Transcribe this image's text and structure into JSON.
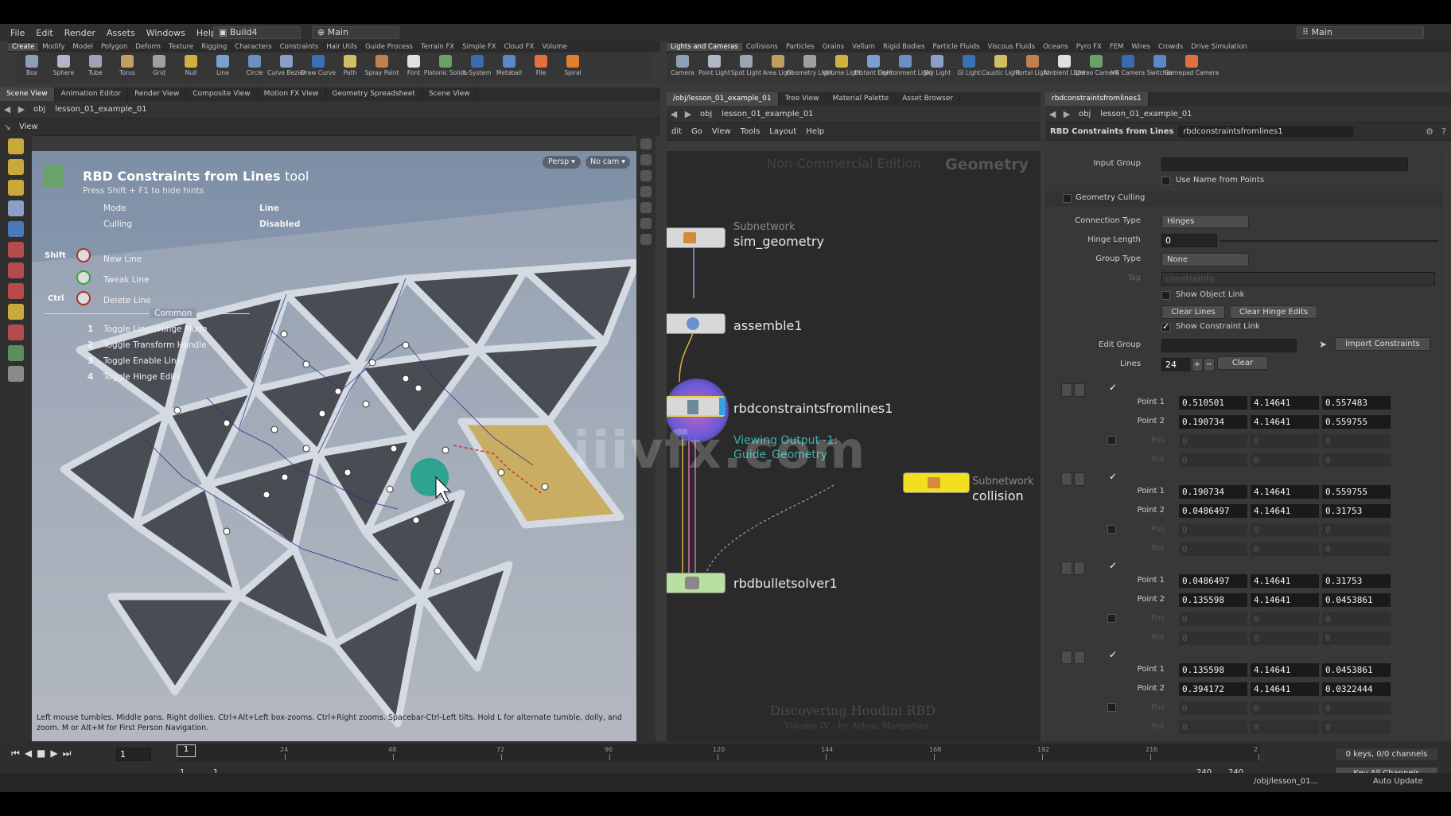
{
  "menubar": {
    "items": [
      "File",
      "Edit",
      "Render",
      "Assets",
      "Windows",
      "Help"
    ],
    "desktop": "Build4",
    "context": "Main",
    "right_context": "Main"
  },
  "shelf_left": {
    "tabs": [
      "Create",
      "Modify",
      "Model",
      "Polygon",
      "Deform",
      "Texture",
      "Rigging",
      "Characters",
      "Constraints",
      "Hair Utils",
      "Guide Process",
      "Terrain FX",
      "Simple FX",
      "Cloud FX",
      "Volume"
    ],
    "tools": [
      "Box",
      "Sphere",
      "Tube",
      "Torus",
      "Grid",
      "Null",
      "Line",
      "Circle",
      "Curve Bezier",
      "Draw Curve",
      "Path",
      "Spray Paint",
      "Font",
      "Platonic Solids",
      "L-System",
      "Metaball",
      "File",
      "Spiral"
    ]
  },
  "shelf_right": {
    "tabs": [
      "Lights and Cameras",
      "Collisions",
      "Particles",
      "Grains",
      "Vellum",
      "Rigid Bodies",
      "Particle Fluids",
      "Viscous Fluids",
      "Oceans",
      "Pyro FX",
      "FEM",
      "Wires",
      "Crowds",
      "Drive Simulation"
    ],
    "tools": [
      "Camera",
      "Point Light",
      "Spot Light",
      "Area Light",
      "Geometry Light",
      "Volume Light",
      "Distant Light",
      "Environment Light",
      "Sky Light",
      "GI Light",
      "Caustic Light",
      "Portal Light",
      "Ambient Light",
      "Stereo Camera",
      "VR Camera",
      "Switcher",
      "Gamepad Camera"
    ]
  },
  "left_pane": {
    "tabs": [
      "Scene View",
      "Animation Editor",
      "Render View",
      "Composite View",
      "Motion FX View",
      "Geometry Spreadsheet",
      "Scene View"
    ],
    "path_root": "obj",
    "path_node": "lesson_01_example_01",
    "view_label": "View",
    "persp": "Persp ▾",
    "cam": "No cam ▾",
    "hint": {
      "title": "RBD Constraints from Lines",
      "title_suffix": "tool",
      "subtitle": "Press Shift + F1 to hide hints",
      "mode_label": "Mode",
      "mode_value": "Line",
      "culling_label": "Culling",
      "culling_value": "Disabled",
      "shift_key": "Shift",
      "ctrl_key": "Ctrl",
      "new_line": "New Line",
      "tweak_line": "Tweak Line",
      "delete_line": "Delete Line",
      "common": "Common",
      "shortcuts": [
        {
          "key": "1",
          "label": "Toggle Lines/Hinge Mode"
        },
        {
          "key": "2",
          "label": "Toggle Transform Handle"
        },
        {
          "key": "3",
          "label": "Toggle Enable Line"
        },
        {
          "key": "4",
          "label": "Toggle Hinge Edits"
        }
      ]
    },
    "help_text": "Left mouse tumbles. Middle pans. Right dollies. Ctrl+Alt+Left box-zooms. Ctrl+Right zooms. Spacebar-Ctrl-Left tilts. Hold L for alternate tumble, dolly, and zoom.    M or Alt+M for First Person Navigation."
  },
  "mid_pane": {
    "tabs": [
      "/obj/lesson_01_example_01",
      "Tree View",
      "Material Palette",
      "Asset Browser"
    ],
    "path_root": "obj",
    "path_node": "lesson_01_example_01",
    "menu": [
      "dit",
      "Go",
      "View",
      "Tools",
      "Layout",
      "Help"
    ],
    "watermark_edition": "Non-Commercial Edition",
    "context_label": "Geometry",
    "nodes": [
      {
        "type": "Subnetwork",
        "name": "sim_geometry"
      },
      {
        "type": "",
        "name": "assemble1"
      },
      {
        "type": "",
        "name": "rbdconstraintsfromlines1"
      },
      {
        "type": "Subnetwork",
        "name": "collision"
      },
      {
        "type": "",
        "name": "rbdbulletsolver1"
      }
    ],
    "viewing_output": "Viewing Output -1:",
    "viewing_output_name": "Guide_Geometry",
    "footer_title": "Discovering Houdini RBD",
    "footer_sub": "Volume IV · by Artem Margarian"
  },
  "params": {
    "tab": "rbdconstraintsfromlines1",
    "path_root": "obj",
    "path_node": "lesson_01_example_01",
    "node_type": "RBD Constraints from Lines",
    "node_name": "rbdconstraintsfromlines1",
    "input_group_label": "Input Group",
    "use_name_label": "Use Name from Points",
    "geometry_culling_label": "Geometry Culling",
    "connection_type_label": "Connection Type",
    "connection_type_value": "Hinges",
    "hinge_length_label": "Hinge Length",
    "hinge_length_value": "0",
    "group_type_label": "Group Type",
    "group_type_value": "None",
    "tag_label": "Tag",
    "tag_value": "constraints",
    "show_object_link": "Show Object Link",
    "clear_lines": "Clear Lines",
    "clear_hinge_edits": "Clear Hinge Edits",
    "show_constraint_link": "Show Constraint Link",
    "edit_group_label": "Edit Group",
    "import_constraints": "Import Constraints",
    "lines_label": "Lines",
    "lines_value": "24",
    "clear": "Clear",
    "point1_label": "Point 1",
    "point2_label": "Point 2",
    "pos_label": "Pos",
    "rot_label": "Rot",
    "lines": [
      {
        "p1": [
          "0.510501",
          "4.14641",
          "0.557483"
        ],
        "p2": [
          "0.190734",
          "4.14641",
          "0.559755"
        ]
      },
      {
        "p1": [
          "0.190734",
          "4.14641",
          "0.559755"
        ],
        "p2": [
          "0.0486497",
          "4.14641",
          "0.31753"
        ]
      },
      {
        "p1": [
          "0.0486497",
          "4.14641",
          "0.31753"
        ],
        "p2": [
          "0.135598",
          "4.14641",
          "0.0453861"
        ]
      },
      {
        "p1": [
          "0.135598",
          "4.14641",
          "0.0453861"
        ],
        "p2": [
          "0.394172",
          "4.14641",
          "0.0322444"
        ]
      }
    ],
    "zero": "0"
  },
  "timeline": {
    "frame": "1",
    "ticks": [
      "24",
      "48",
      "72",
      "96",
      "120",
      "144",
      "168",
      "192",
      "216",
      "2"
    ],
    "start": "1",
    "start2": "1",
    "end": "240",
    "end2": "240",
    "keys": "0 keys, 0/0 channels",
    "key_all": "Key All Channels",
    "status_path": "/obj/lesson_01...",
    "auto_update": "Auto Update"
  },
  "watermark": "iiivfx.com"
}
